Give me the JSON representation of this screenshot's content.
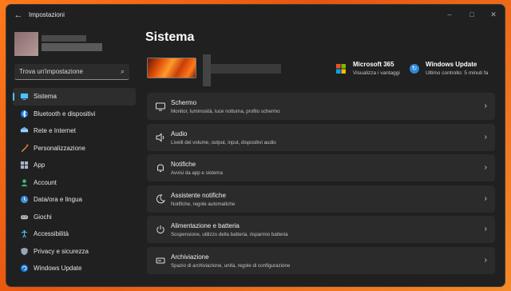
{
  "window": {
    "title": "Impostazioni",
    "back_icon": "back-arrow-icon"
  },
  "search": {
    "placeholder": "Trova un'impostazione"
  },
  "sidebar": {
    "items": [
      {
        "label": "Sistema",
        "icon": "monitor-icon",
        "active": true
      },
      {
        "label": "Bluetooth e dispositivi",
        "icon": "bluetooth-icon"
      },
      {
        "label": "Rete e Internet",
        "icon": "network-icon"
      },
      {
        "label": "Personalizzazione",
        "icon": "brush-icon"
      },
      {
        "label": "App",
        "icon": "apps-icon"
      },
      {
        "label": "Account",
        "icon": "person-icon"
      },
      {
        "label": "Data/ora e lingua",
        "icon": "globe-clock-icon"
      },
      {
        "label": "Giochi",
        "icon": "gamepad-icon"
      },
      {
        "label": "Accessibilità",
        "icon": "accessibility-icon"
      },
      {
        "label": "Privacy e sicurezza",
        "icon": "shield-icon"
      },
      {
        "label": "Windows Update",
        "icon": "update-icon"
      }
    ]
  },
  "main": {
    "title": "Sistema",
    "ms365": {
      "title": "Microsoft 365",
      "subtitle": "Visualizza i vantaggi"
    },
    "windows_update": {
      "title": "Windows Update",
      "subtitle": "Ultimo controllo: 5 minuti fa"
    },
    "cards": [
      {
        "title": "Schermo",
        "subtitle": "Monitor, luminosità, luce notturna, profilo schermo",
        "icon": "display-icon"
      },
      {
        "title": "Audio",
        "subtitle": "Livelli del volume, output, input, dispositivi audio",
        "icon": "speaker-icon"
      },
      {
        "title": "Notifiche",
        "subtitle": "Avvisi da app e sistema",
        "icon": "bell-icon"
      },
      {
        "title": "Assistente notifiche",
        "subtitle": "Notifiche, regole automatiche",
        "icon": "moon-icon"
      },
      {
        "title": "Alimentazione e batteria",
        "subtitle": "Sospensione, utilizzo della batteria, risparmio batteria",
        "icon": "power-icon"
      },
      {
        "title": "Archiviazione",
        "subtitle": "Spazio di archiviazione, unità, regole di configurazione",
        "icon": "storage-icon"
      }
    ]
  },
  "colors": {
    "accent": "#4cc2ff",
    "background": "#202020",
    "card": "#2b2b2b",
    "wallpaper": "#f07a1e"
  }
}
